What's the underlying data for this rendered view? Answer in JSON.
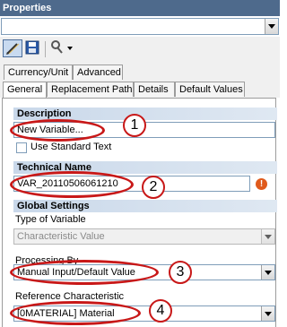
{
  "window": {
    "title": "Properties"
  },
  "tabs_row1": [
    "Currency/Unit",
    "Advanced"
  ],
  "tabs_row2": [
    "General",
    "Replacement Path",
    "Details",
    "Default Values"
  ],
  "general": {
    "description": {
      "section": "Description",
      "value": "New Variable...",
      "checkbox_label": "Use Standard Text"
    },
    "technical_name": {
      "section": "Technical Name",
      "value": "VAR_20110506061210"
    },
    "global_settings": {
      "section": "Global Settings",
      "type_label": "Type of Variable",
      "type_value": "Characteristic Value",
      "processing_label": "Processing By",
      "processing_value": "Manual Input/Default Value",
      "reference_label": "Reference Characteristic",
      "reference_value": "[0MATERIAL] Material"
    }
  },
  "callouts": [
    "1",
    "2",
    "3",
    "4"
  ],
  "error_icon": "!",
  "colors": {
    "title_bar": "#4e6a8c",
    "highlight": "#c81818",
    "section_bg": "#c9d8ea"
  }
}
